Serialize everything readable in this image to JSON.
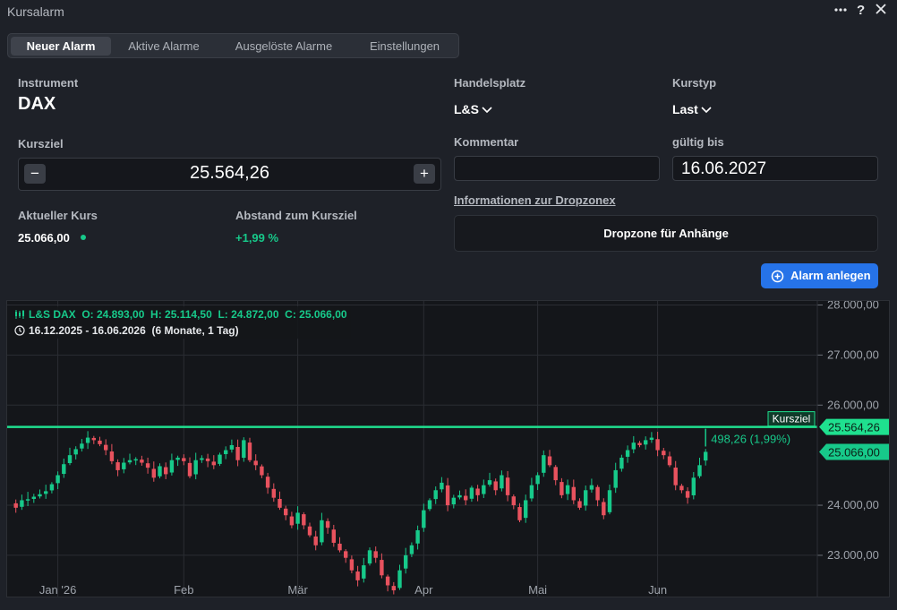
{
  "window": {
    "title": "Kursalarm",
    "more_icon": "ellipsis-icon",
    "help_label": "?",
    "close_icon": "close-icon"
  },
  "tabs": [
    {
      "label": "Neuer Alarm",
      "active": true
    },
    {
      "label": "Aktive Alarme",
      "active": false
    },
    {
      "label": "Ausgelöste Alarme",
      "active": false
    },
    {
      "label": "Einstellungen",
      "active": false
    }
  ],
  "form": {
    "instrument_label": "Instrument",
    "instrument_value": "DAX",
    "kursziel_label": "Kursziel",
    "kursziel_value": "25.564,26",
    "minus_label": "−",
    "plus_label": "+",
    "aktueller_kurs_label": "Aktueller Kurs",
    "aktueller_kurs_value": "25.066,00",
    "abstand_label": "Abstand zum Kursziel",
    "abstand_value": "+1,99 %",
    "handelsplatz_label": "Handelsplatz",
    "handelsplatz_value": "L&S",
    "kurstyp_label": "Kurstyp",
    "kurstyp_value": "Last",
    "kommentar_label": "Kommentar",
    "kommentar_value": "",
    "gueltig_label": "gültig bis",
    "gueltig_value": "16.06.2027",
    "info_link": "Informationen zur Dropzonex",
    "dropzone_label": "Dropzone für Anhänge",
    "submit_label": "Alarm anlegen"
  },
  "colors": {
    "up": "#17c98a",
    "down": "#e8525e",
    "accent": "#2673e8",
    "target_line": "#1fe08f"
  },
  "chart_data": {
    "type": "candlestick",
    "legend_ohlc": "L&S DAX  O: 24.893,00  H: 25.114,50  L: 24.872,00  C: 25.066,00",
    "legend_range": "16.12.2025 - 16.06.2026  (6 Monate, 1 Tag)",
    "x_labels": [
      {
        "label": "Jan '26",
        "index": 8
      },
      {
        "label": "Feb",
        "index": 29
      },
      {
        "label": "Mär",
        "index": 48
      },
      {
        "label": "Apr",
        "index": 69
      },
      {
        "label": "Mai",
        "index": 88
      },
      {
        "label": "Jun",
        "index": 108
      }
    ],
    "y_ticks": [
      {
        "value": 28000,
        "label": "28.000,00"
      },
      {
        "value": 27000,
        "label": "27.000,00"
      },
      {
        "value": 26000,
        "label": "26.000,00"
      },
      {
        "value": 24000,
        "label": "24.000,00"
      },
      {
        "value": 23000,
        "label": "23.000,00"
      }
    ],
    "ylim": [
      22140,
      28080
    ],
    "kursziel": {
      "value": 25564.26,
      "line_label": "Kursziel",
      "price_label": "25.564,26"
    },
    "current": {
      "value": 25066,
      "price_label": "25.066,00"
    },
    "distance_annotation": "498,26 (1,99%)",
    "closes": [
      24050,
      23950,
      24100,
      24120,
      24170,
      24220,
      24280,
      24420,
      24600,
      24820,
      25000,
      25120,
      25230,
      25350,
      25300,
      25220,
      25100,
      24880,
      24700,
      24850,
      24900,
      24920,
      24850,
      24750,
      24550,
      24780,
      24620,
      24900,
      24950,
      24880,
      24580,
      24900,
      24940,
      24880,
      24800,
      25010,
      25100,
      25200,
      24900,
      25300,
      24900,
      24800,
      24600,
      24350,
      24150,
      23950,
      23800,
      23600,
      23850,
      23600,
      23400,
      23200,
      23700,
      23550,
      23250,
      23100,
      22950,
      22700,
      22500,
      22800,
      23100,
      22950,
      22600,
      22400,
      22300,
      22700,
      23000,
      23200,
      23500,
      23900,
      24100,
      24300,
      24450,
      24000,
      24150,
      24200,
      24100,
      24350,
      24200,
      24400,
      24500,
      24300,
      24600,
      24200,
      24000,
      23700,
      24100,
      24400,
      24600,
      25000,
      24800,
      24500,
      24200,
      24400,
      24100,
      23950,
      24300,
      24400,
      24100,
      23800,
      24300,
      24700,
      24950,
      25100,
      25250,
      25200,
      25300,
      25350,
      25100,
      25000,
      24800,
      24400,
      24300,
      24150,
      24550,
      24800,
      25066
    ]
  }
}
